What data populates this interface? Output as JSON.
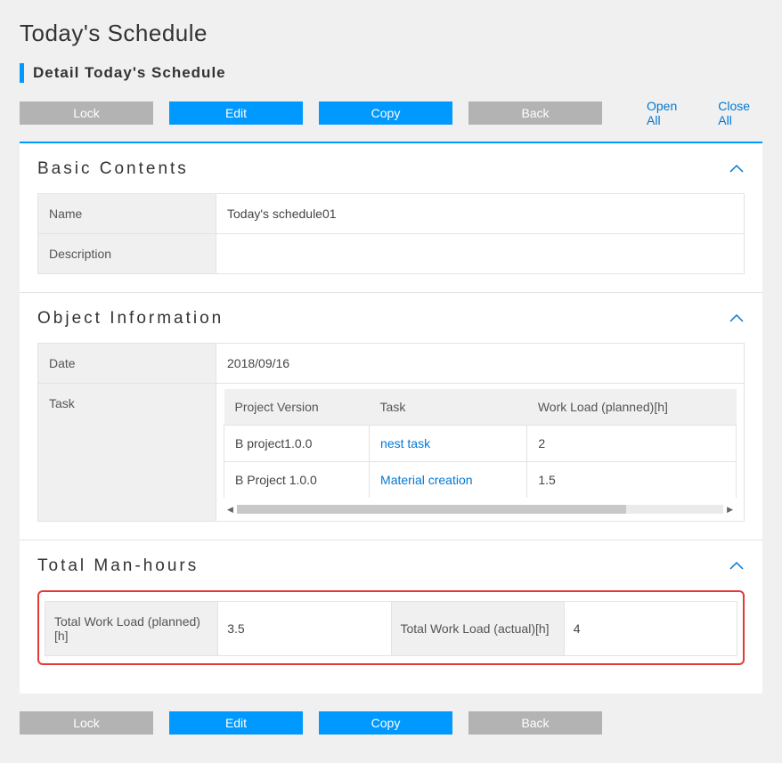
{
  "page_title": "Today's Schedule",
  "subtitle": "Detail Today's Schedule",
  "toolbar": {
    "lock": "Lock",
    "edit": "Edit",
    "copy": "Copy",
    "back": "Back",
    "open_all": "Open All",
    "close_all": "Close All"
  },
  "sections": {
    "basic": {
      "title": "Basic Contents",
      "name_label": "Name",
      "name_value": "Today's schedule01",
      "description_label": "Description",
      "description_value": ""
    },
    "object_info": {
      "title": "Object Information",
      "date_label": "Date",
      "date_value": "2018/09/16",
      "task_label": "Task",
      "task_table": {
        "headers": {
          "project_version": "Project Version",
          "task": "Task",
          "work_load": "Work Load (planned)[h]"
        },
        "rows": [
          {
            "project_version": "B project1.0.0",
            "task": "nest task",
            "work_load": "2"
          },
          {
            "project_version": "B Project 1.0.0",
            "task": "Material creation",
            "work_load": "1.5"
          }
        ]
      }
    },
    "totals": {
      "title": "Total Man-hours",
      "planned_label": "Total Work Load (planned)[h]",
      "planned_value": "3.5",
      "actual_label": "Total Work Load (actual)[h]",
      "actual_value": "4"
    }
  }
}
